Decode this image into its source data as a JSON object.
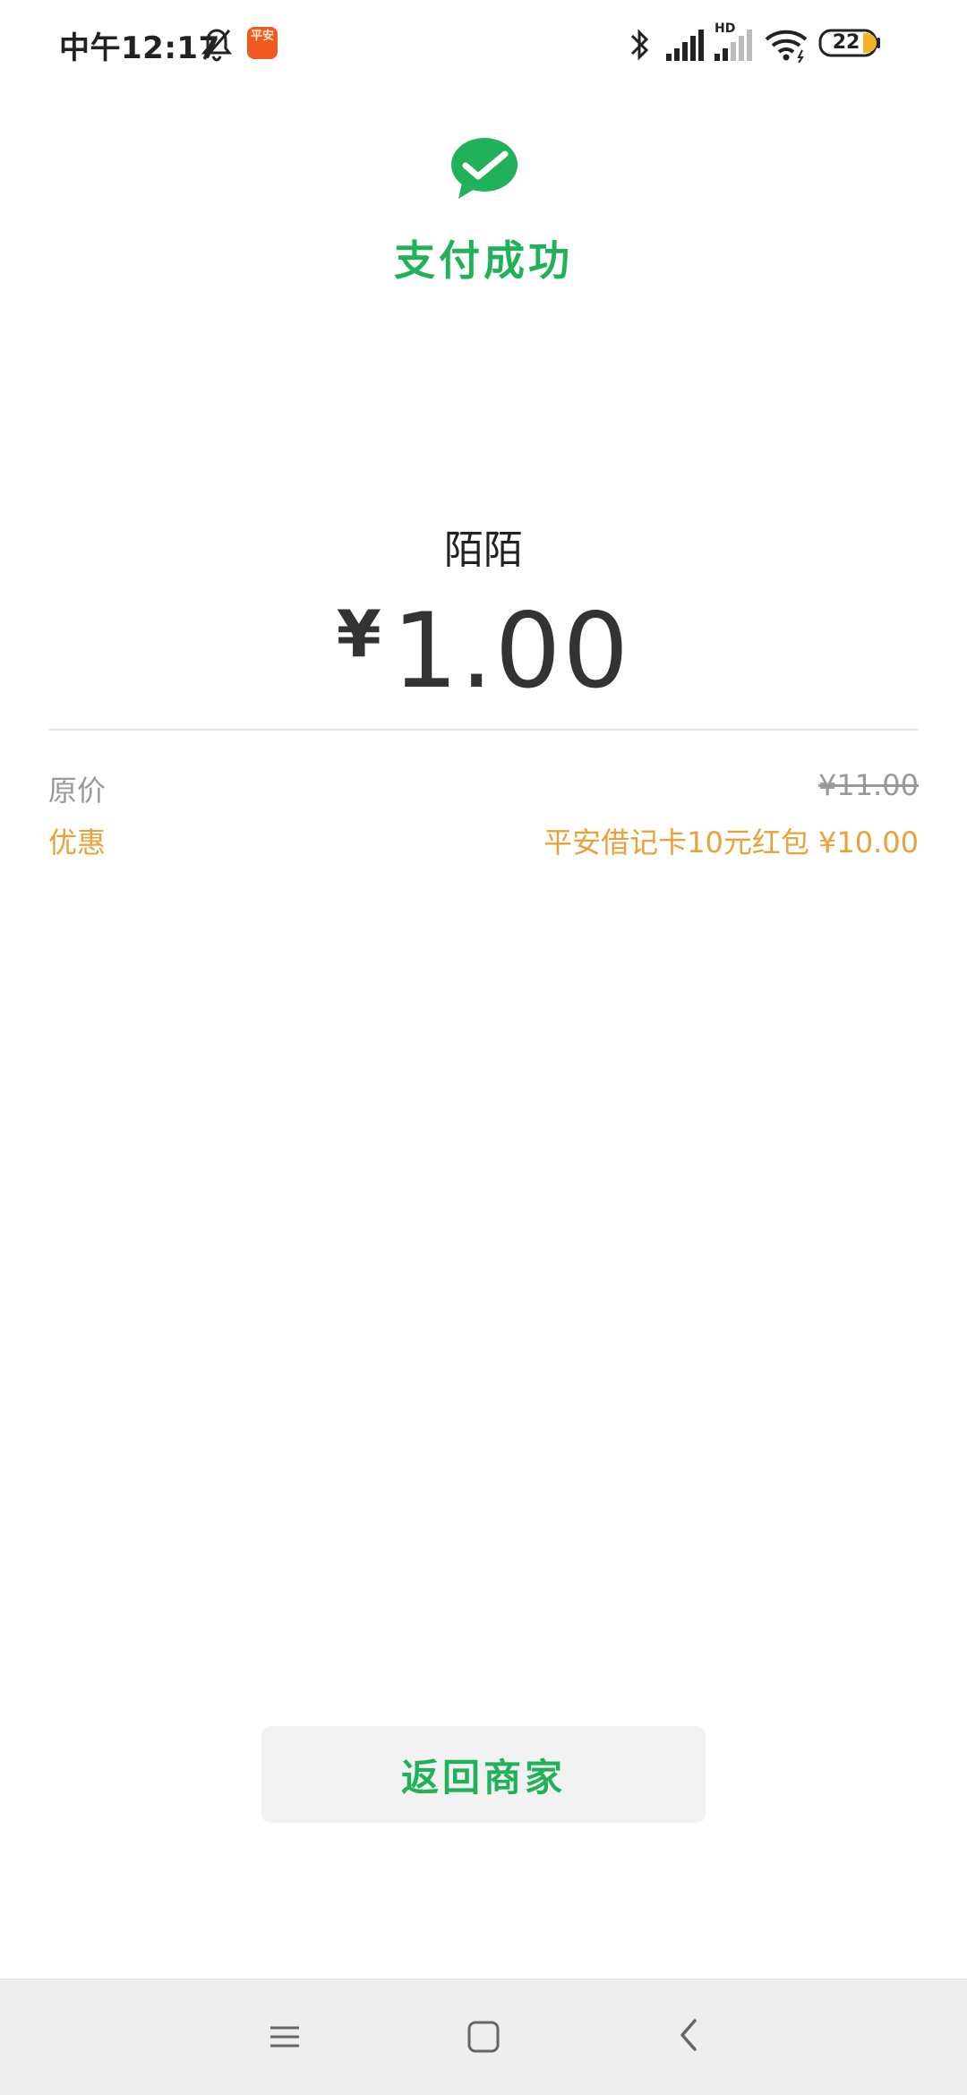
{
  "status_bar": {
    "time": "中午12:17",
    "app_icon_text": "平安",
    "network_badge": "HD",
    "battery_level": "22"
  },
  "header": {
    "icon": "wechat-pay-check-icon",
    "title": "支付成功",
    "accent_color": "#20b15a"
  },
  "payment": {
    "merchant": "陌陌",
    "currency": "¥",
    "amount": "1.00"
  },
  "details": {
    "original_label": "原价",
    "original_value": "¥11.00",
    "discount_label": "优惠",
    "discount_value": "平安借记卡10元红包 ¥10.00",
    "discount_color": "#e9a13a"
  },
  "actions": {
    "back_label": "返回商家"
  },
  "nav_bar": {
    "icons": [
      "menu-icon",
      "home-icon",
      "back-icon"
    ]
  }
}
